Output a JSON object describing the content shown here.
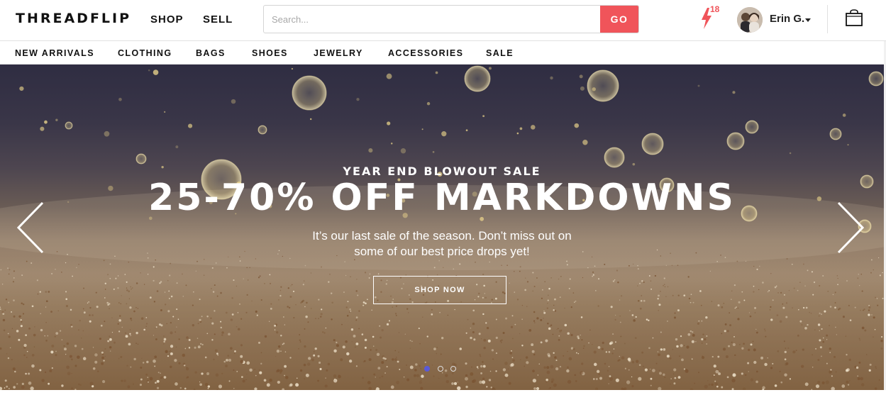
{
  "header": {
    "logo": "THREADFLIP",
    "nav": [
      "SHOP",
      "SELL"
    ],
    "search": {
      "placeholder": "Search...",
      "value": "",
      "button_label": "GO"
    },
    "notifications_count": "18",
    "user_name": "Erin G.",
    "colors": {
      "accent": "#f0545a"
    }
  },
  "categories": [
    "NEW ARRIVALS",
    "CLOTHING",
    "BAGS",
    "SHOES",
    "JEWELRY",
    "ACCESSORIES",
    "SALE"
  ],
  "hero": {
    "kicker": "YEAR END BLOWOUT SALE",
    "title": "25-70% OFF MARKDOWNS",
    "subtitle": "It’s our last sale of the season. Don’t miss out on some of our best price drops yet!",
    "cta_label": "SHOP NOW",
    "slides_total": 3,
    "active_slide": 1,
    "icons": {
      "prev": "chevron-left-icon",
      "next": "chevron-right-icon"
    }
  }
}
